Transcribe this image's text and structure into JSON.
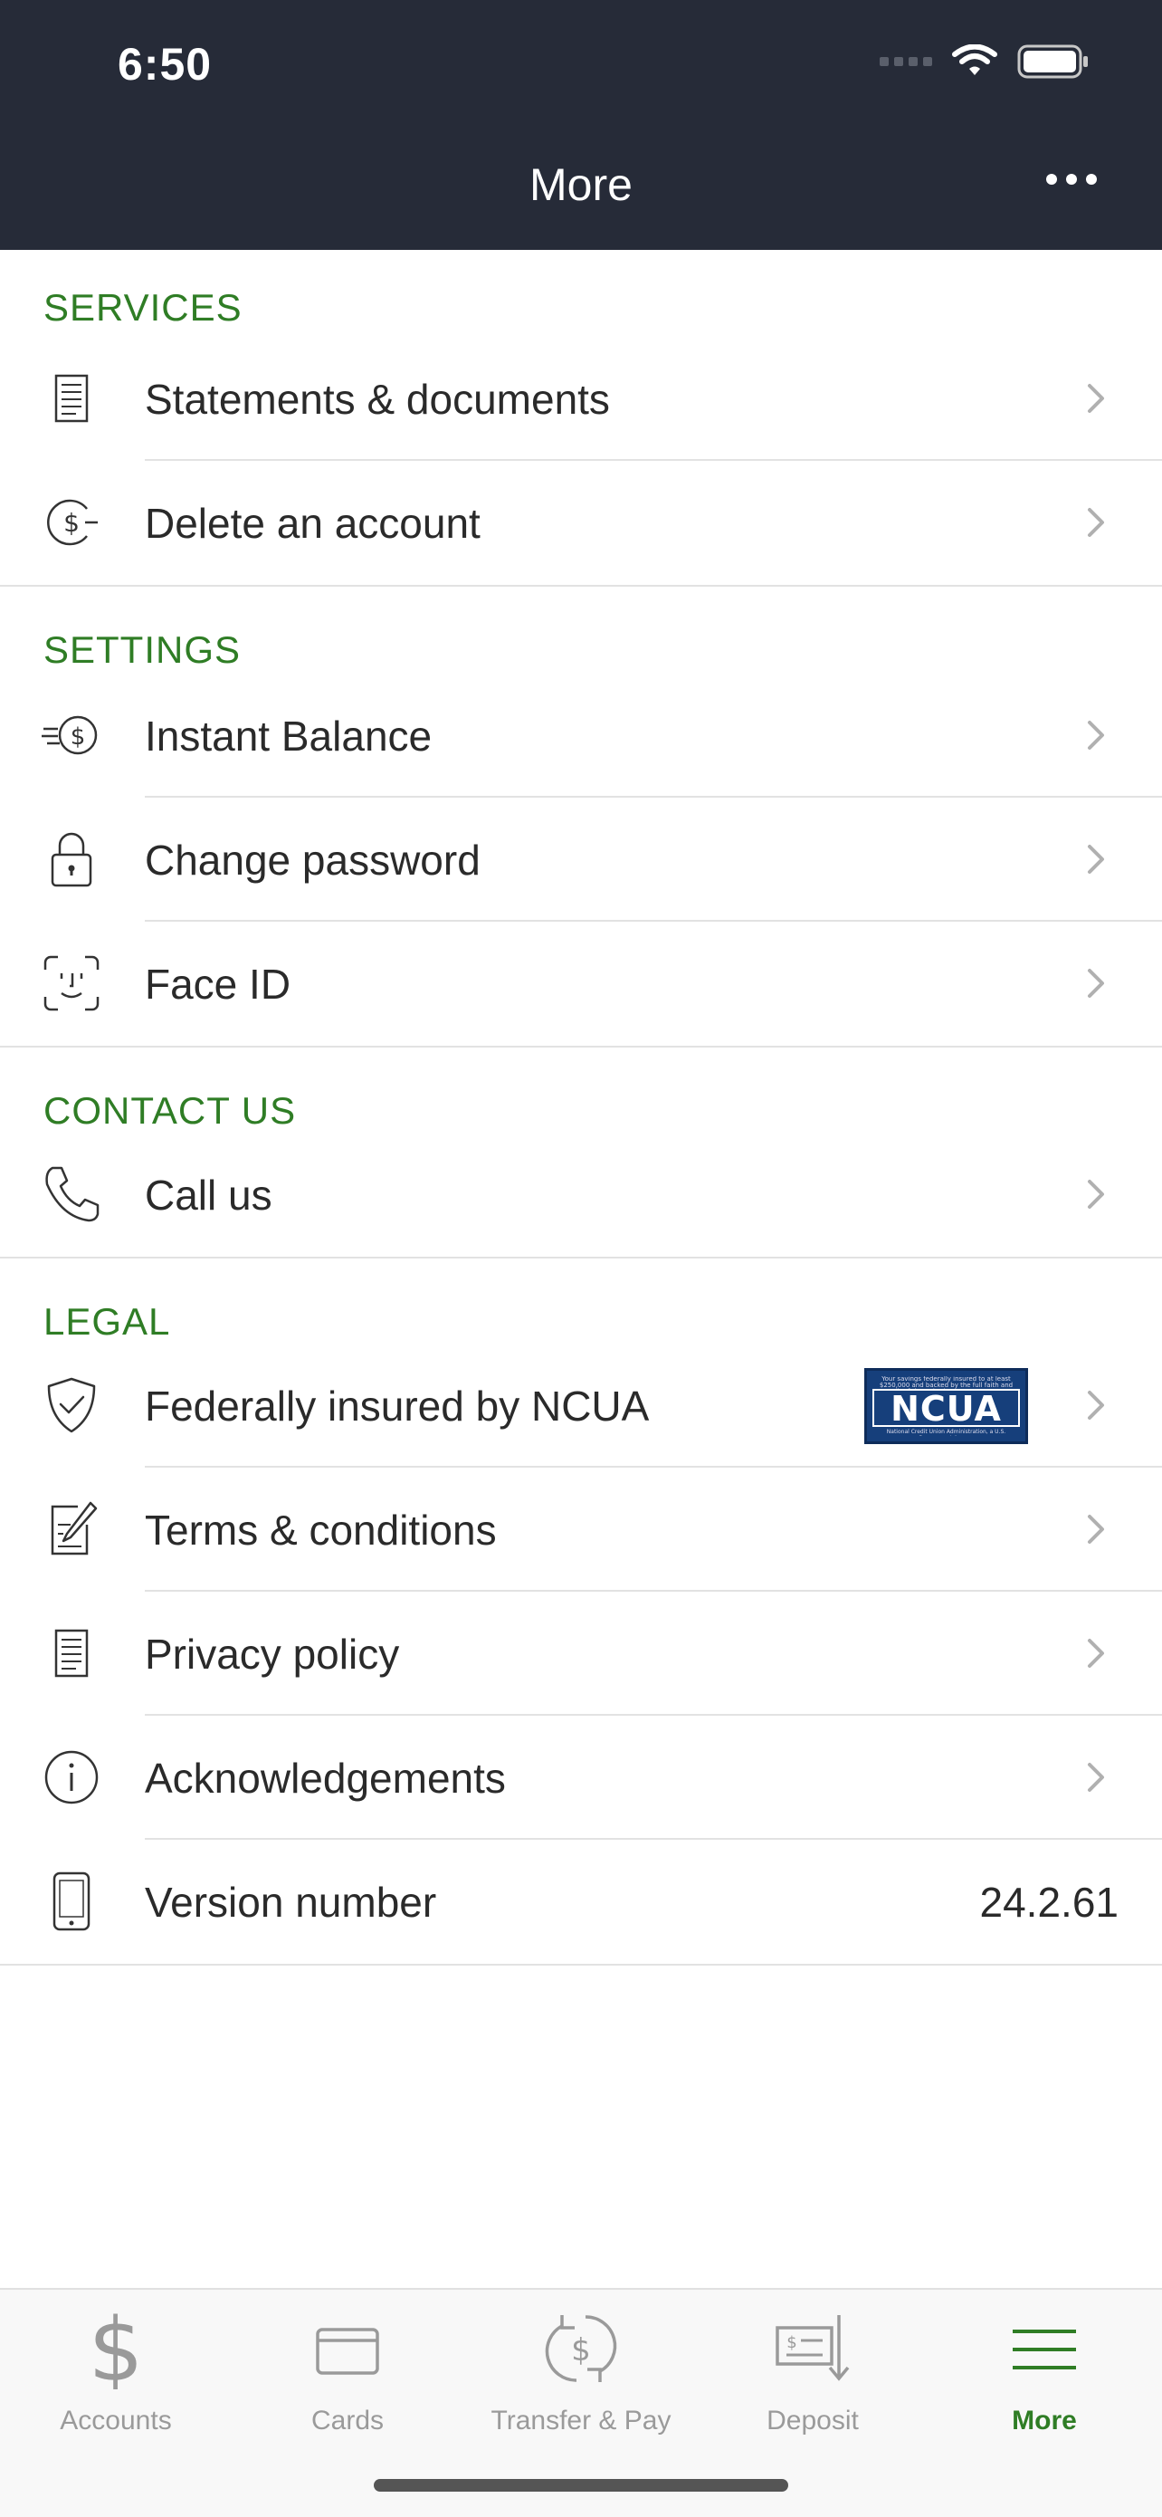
{
  "status_bar": {
    "time": "6:50"
  },
  "header": {
    "title": "More"
  },
  "sections": [
    {
      "title": "SERVICES",
      "items": [
        {
          "label": "Statements & documents",
          "icon": "document-icon"
        },
        {
          "label": "Delete an account",
          "icon": "dollar-minus-icon"
        }
      ]
    },
    {
      "title": "SETTINGS",
      "items": [
        {
          "label": "Instant Balance",
          "icon": "fast-dollar-icon"
        },
        {
          "label": "Change password",
          "icon": "lock-icon"
        },
        {
          "label": "Face ID",
          "icon": "face-id-icon"
        }
      ]
    },
    {
      "title": "CONTACT US",
      "items": [
        {
          "label": "Call us",
          "icon": "phone-icon"
        }
      ]
    },
    {
      "title": "LEGAL",
      "items": [
        {
          "label": "Federally insured by NCUA",
          "icon": "shield-check-icon"
        },
        {
          "label": "Terms & conditions",
          "icon": "pencil-document-icon"
        },
        {
          "label": "Privacy policy",
          "icon": "document-icon"
        },
        {
          "label": "Acknowledgements",
          "icon": "info-icon"
        },
        {
          "label": "Version number",
          "icon": "phone-device-icon",
          "value": "24.2.61"
        }
      ]
    }
  ],
  "ncua_badge": {
    "text": "NCUA",
    "fine_top": "Your savings federally insured to at least $250,000 and backed by the full faith and credit of the United States Government",
    "fine_bottom": "National Credit Union Administration, a U.S. Government Agency"
  },
  "tabs": [
    {
      "label": "Accounts",
      "icon": "dollar-icon",
      "active": false
    },
    {
      "label": "Cards",
      "icon": "card-icon",
      "active": false
    },
    {
      "label": "Transfer & Pay",
      "icon": "transfer-icon",
      "active": false
    },
    {
      "label": "Deposit",
      "icon": "check-deposit-icon",
      "active": false
    },
    {
      "label": "More",
      "icon": "menu-icon",
      "active": true
    }
  ],
  "colors": {
    "header_bg": "#262b38",
    "accent_green": "#2f7d25",
    "inactive_gray": "#9a9a9a"
  }
}
